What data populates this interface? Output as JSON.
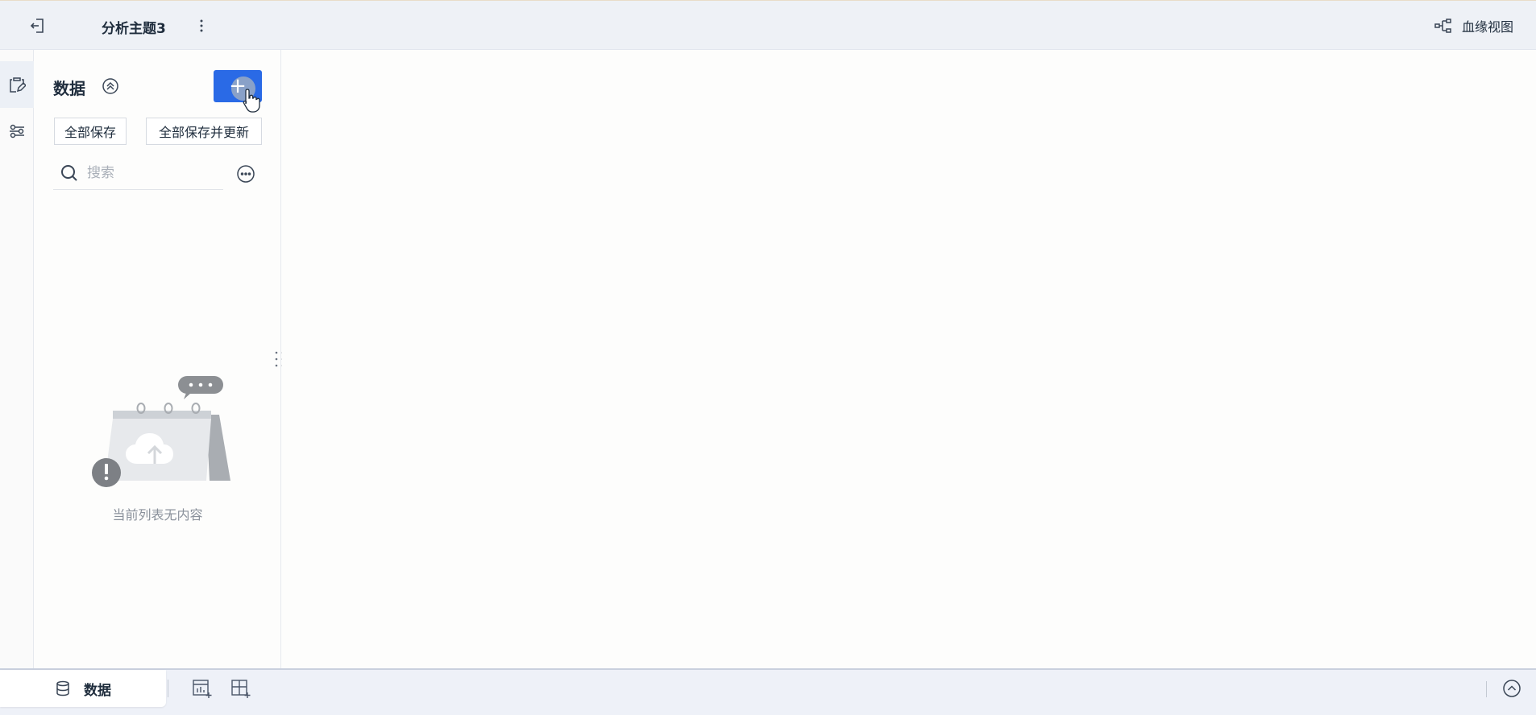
{
  "header": {
    "title": "分析主题3",
    "lineage_label": "血缘视图",
    "back_icon": "exit-icon",
    "more_icon": "vertical-ellipsis-icon",
    "lineage_icon": "lineage-graph-icon"
  },
  "rail": {
    "items": [
      {
        "icon": "clipboard-edit-icon",
        "active": true
      },
      {
        "icon": "sliders-icon",
        "active": false
      }
    ]
  },
  "panel": {
    "title": "数据",
    "add_label": "+",
    "save_all_label": "全部保存",
    "save_all_update_label": "全部保存并更新",
    "search": {
      "placeholder": "搜索",
      "value": ""
    },
    "empty_text": "当前列表无内容"
  },
  "bottom": {
    "data_tab_label": "数据",
    "icons": [
      "add-chart-icon",
      "add-dashboard-icon",
      "chevron-up-circle-icon"
    ]
  },
  "colors": {
    "accent": "#2a6ae6",
    "header_bg": "#eef1f6",
    "text": "#1f2d3d",
    "muted": "#8a919b"
  }
}
